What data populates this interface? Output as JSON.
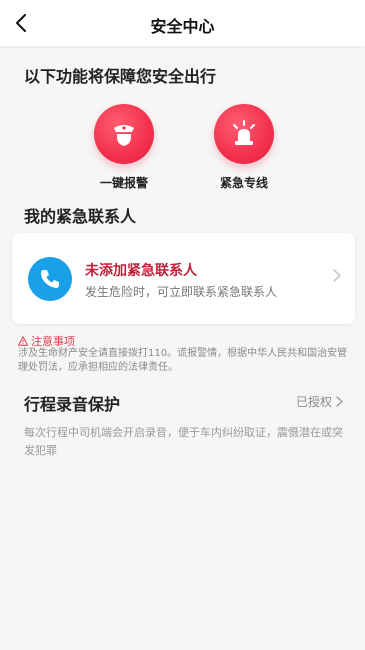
{
  "header": {
    "title": "安全中心"
  },
  "protection": {
    "title": "以下功能将保障您安全出行",
    "actions": [
      {
        "label": "一键报警",
        "icon": "police-icon"
      },
      {
        "label": "紧急专线",
        "icon": "alarm-light-icon"
      }
    ]
  },
  "contacts": {
    "title": "我的紧急联系人",
    "card_title": "未添加紧急联系人",
    "card_subtitle": "发生危险时，可立即联系紧急联系人"
  },
  "notice": {
    "title": "注意事项",
    "text": "涉及生命财产安全请直接拨打110。谎报警情，根据中华人民共和国治安管理处罚法，应承担相应的法律责任。"
  },
  "recording": {
    "title": "行程录音保护",
    "status": "已授权",
    "description": "每次行程中司机端会开启录音，便于车内纠纷取证，震慑潜在或突发犯罪"
  },
  "colors": {
    "accent_red": "#f2304e",
    "phone_blue": "#1aa0e8"
  }
}
